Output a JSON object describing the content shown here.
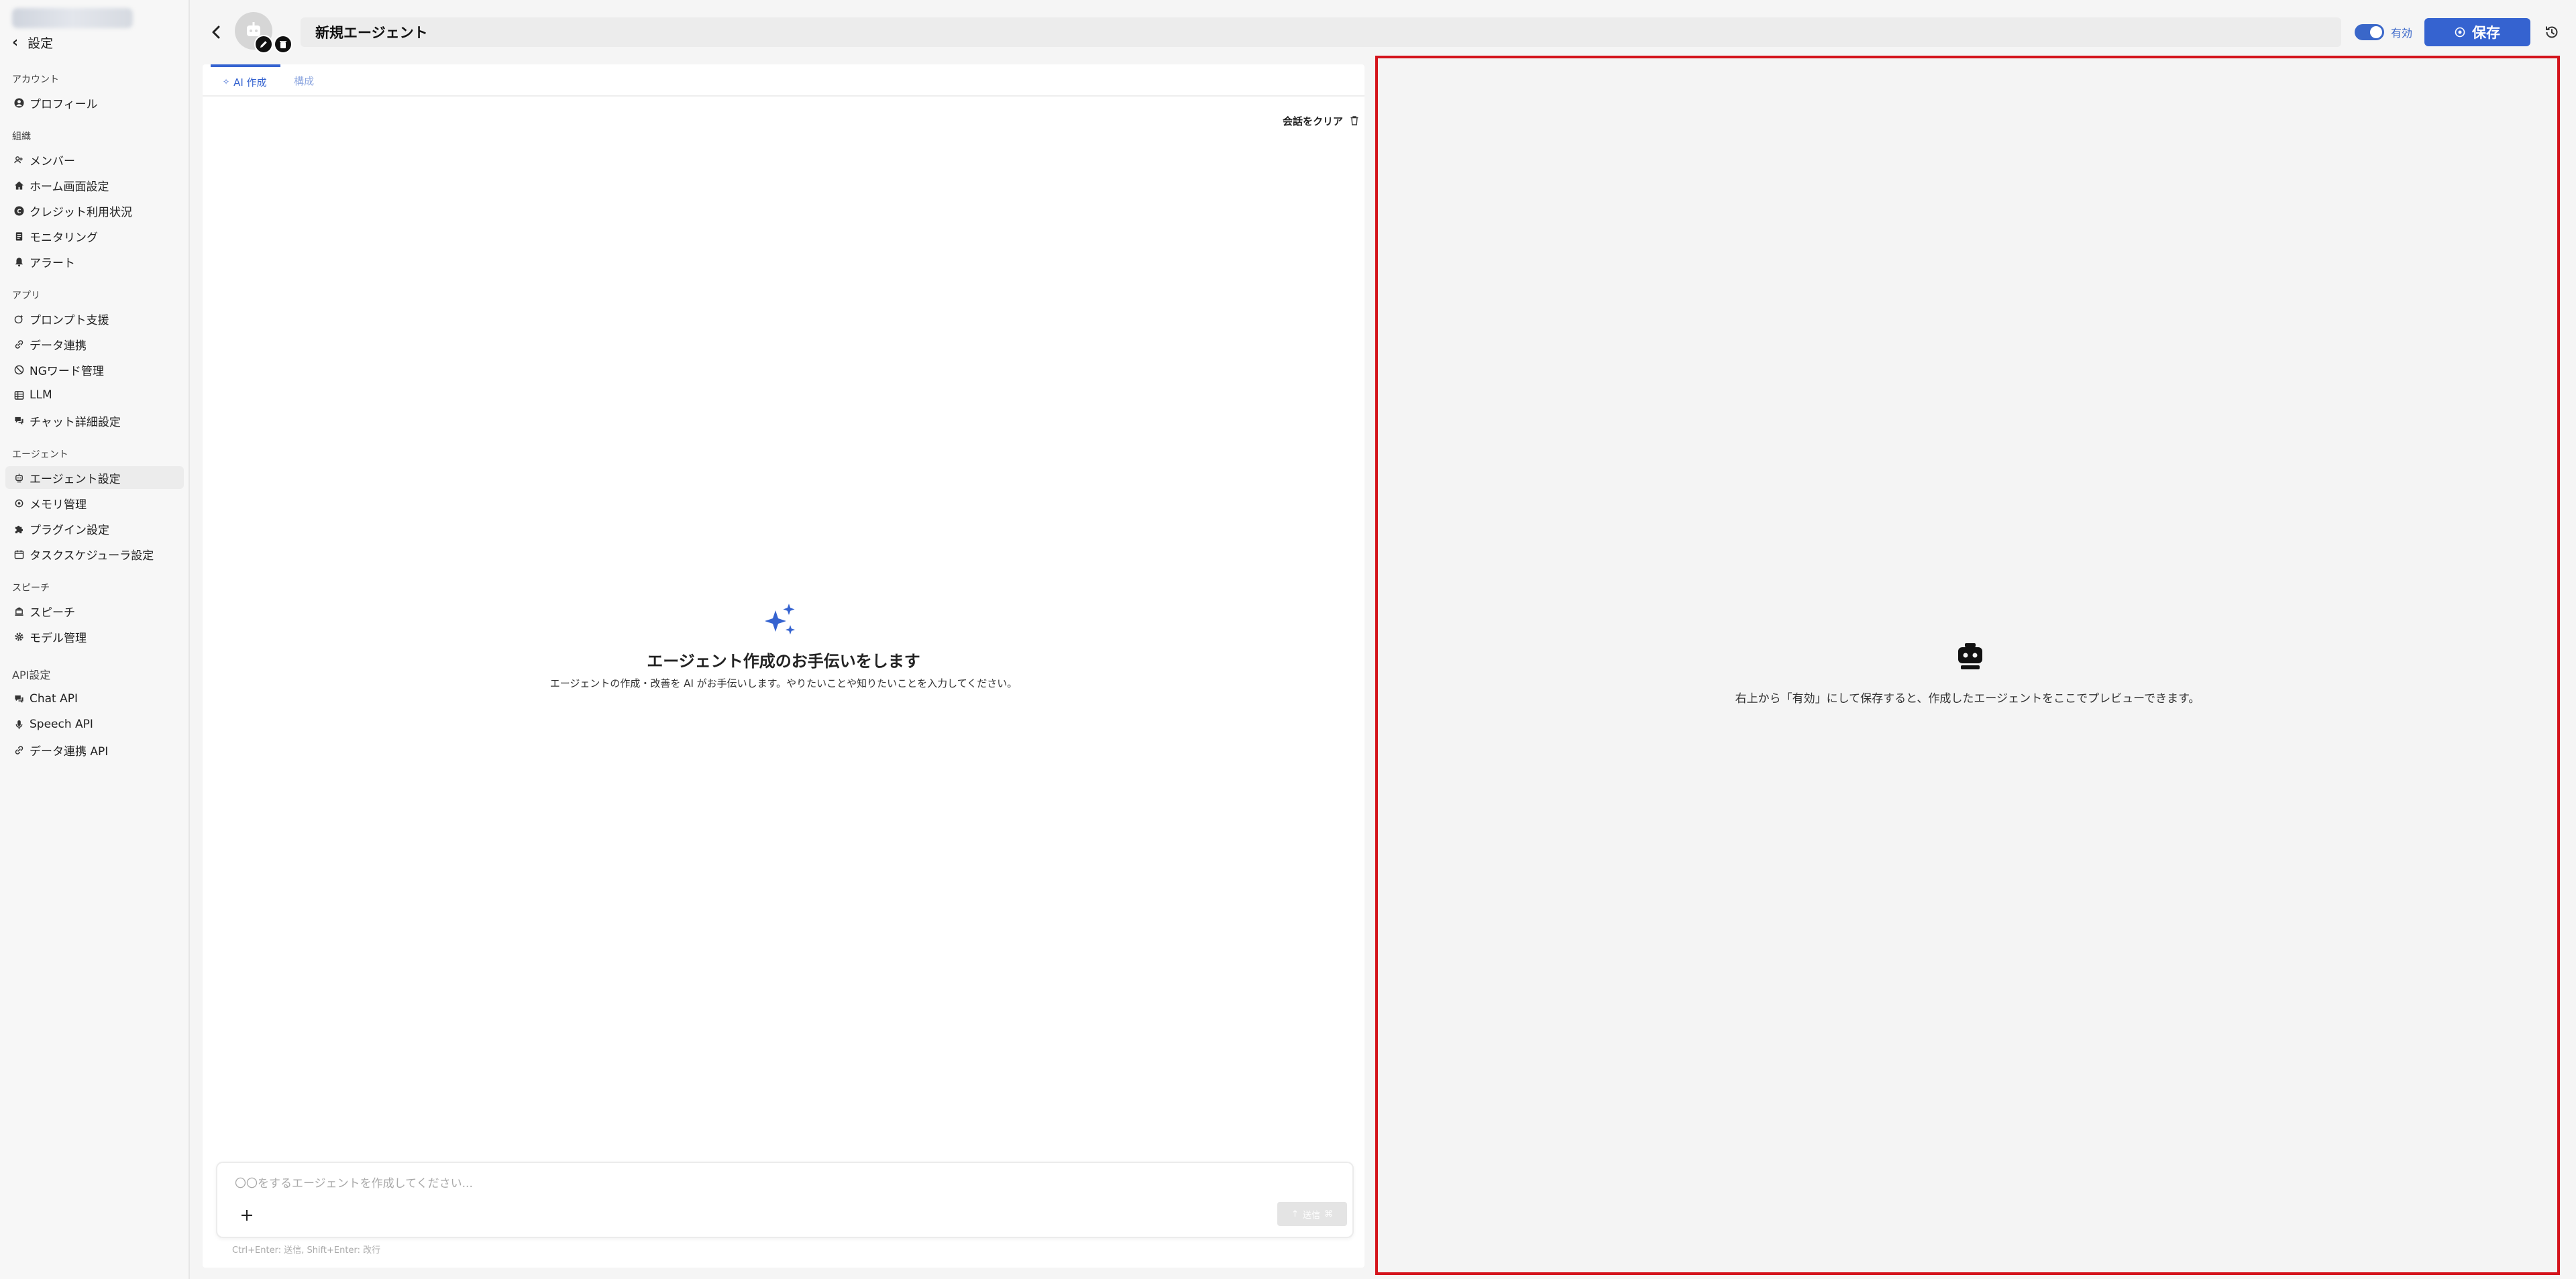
{
  "sidebar": {
    "back_label": "設定",
    "sections": {
      "account": "アカウント",
      "org": "組織",
      "app": "アプリ",
      "agent": "エージェント",
      "speech": "スピーチ",
      "api": "API設定"
    },
    "items": {
      "profile": "プロフィール",
      "members": "メンバー",
      "home": "ホーム画面設定",
      "credit": "クレジット利用状況",
      "monitoring": "モニタリング",
      "alert": "アラート",
      "prompt": "プロンプト支援",
      "data_link": "データ連携",
      "ngword": "NGワード管理",
      "llm": "LLM",
      "chat_detail": "チャット詳細設定",
      "agent_settings": "エージェント設定",
      "memory": "メモリ管理",
      "plugin": "プラグイン設定",
      "scheduler": "タスクスケジューラ設定",
      "speech": "スピーチ",
      "model": "モデル管理",
      "chat_api": "Chat API",
      "speech_api": "Speech API",
      "data_api": "データ連携 API"
    },
    "active_item": "agent_settings"
  },
  "header": {
    "agent_name": "新規エージェント",
    "toggle_label": "有効",
    "toggle_on": true,
    "save_label": "保存"
  },
  "tabs": {
    "ai_create": "AI 作成",
    "config": "構成"
  },
  "chat": {
    "clear_label": "会話をクリア",
    "assist_title": "エージェント作成のお手伝いをします",
    "assist_desc": "エージェントの作成・改善を AI がお手伝いします。やりたいことや知りたいことを入力してください。",
    "input_placeholder": "〇〇をするエージェントを作成してください...",
    "send_label": "送信",
    "hint": "Ctrl+Enter: 送信, Shift+Enter: 改行"
  },
  "preview": {
    "empty_text": "右上から「有効」にして保存すると、作成したエージェントをここでプレビューできます。"
  },
  "colors": {
    "accent": "#3563d0",
    "highlight_border": "#d4141c",
    "sidebar_bg": "#f7f7f7"
  }
}
